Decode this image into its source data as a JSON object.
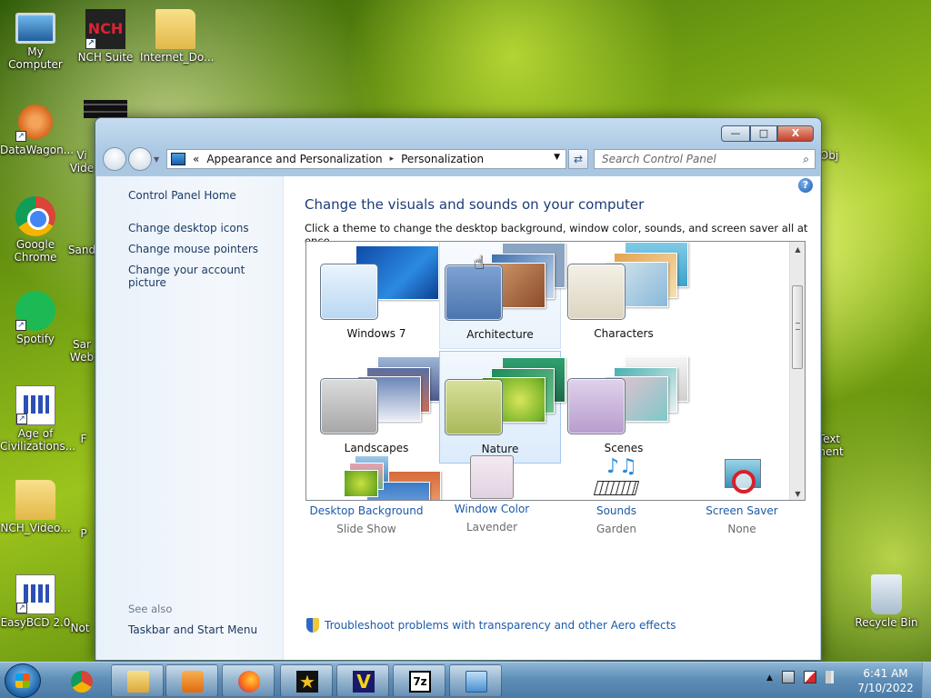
{
  "desktop": {
    "icons": [
      {
        "label": "My Computer"
      },
      {
        "label": "NCH Suite"
      },
      {
        "label": "Internet_Do..."
      },
      {
        "label": "DataWagon..."
      },
      {
        "label": "Google Chrome"
      },
      {
        "label": "Spotify"
      },
      {
        "label": "Age of Civilizations..."
      },
      {
        "label": "NCH_Video..."
      },
      {
        "label": "EasyBCD 2.0"
      },
      {
        "label": "Recycle Bin"
      }
    ],
    "partial_labels": [
      "Vi",
      "Vide",
      "Sand",
      "Sar",
      "Web",
      "F",
      "P",
      "Not",
      "Obj",
      "Text",
      "ment"
    ]
  },
  "window": {
    "buttons": {
      "minimize": "—",
      "maximize": "□",
      "close": "X"
    },
    "address": {
      "chevrons": "«",
      "crumbs": [
        "Appearance and Personalization",
        "Personalization"
      ],
      "separator": "▸",
      "dropdown": "▼"
    },
    "refresh_glyph": "⇄",
    "search": {
      "placeholder": "Search Control Panel",
      "icon": "⌕"
    },
    "left_pane": {
      "home": "Control Panel Home",
      "links": [
        "Change desktop icons",
        "Change mouse pointers",
        "Change your account picture"
      ],
      "see_also": "See also",
      "see_also_links": [
        "Taskbar and Start Menu"
      ]
    },
    "help": "?",
    "title": "Change the visuals and sounds on your computer",
    "description": "Click a theme to change the desktop background, window color, sounds, and screen saver all at once.",
    "themes": [
      {
        "name": "Windows 7",
        "swatch": "#cfe4f7",
        "cards": [
          "#1a57b8",
          "#2f7fd6"
        ]
      },
      {
        "name": "Architecture",
        "swatch": "#6a8fc4",
        "cards": [
          "#8aa4c2",
          "#c4874f",
          "#3d6fae"
        ]
      },
      {
        "name": "Characters",
        "swatch": "#e8e2d4",
        "cards": [
          "#7fcbe8",
          "#e4a24f",
          "#89b9d9"
        ]
      },
      {
        "name": "Landscapes",
        "swatch": "#b8b8b8",
        "cards": [
          "#9db5d8",
          "#4c5a8a",
          "#d8d4d0"
        ]
      },
      {
        "name": "Nature",
        "swatch": "#b9c873",
        "cards": [
          "#1e8a5a",
          "#7bb52b",
          "#b3d23d"
        ]
      },
      {
        "name": "Scenes",
        "swatch": "#c7b3d8",
        "cards": [
          "#e8e8e8",
          "#4ab0b0",
          "#f0c0d0"
        ]
      }
    ],
    "scroll": {
      "up": "▲",
      "down": "▼"
    },
    "bottom_items": [
      {
        "label": "Desktop Background",
        "sub": "Slide Show"
      },
      {
        "label": "Window Color",
        "sub": "Lavender",
        "color": "#ece1ea"
      },
      {
        "label": "Sounds",
        "sub": "Garden"
      },
      {
        "label": "Screen Saver",
        "sub": "None"
      }
    ],
    "troubleshoot": "Troubleshoot problems with transparency and other Aero effects"
  },
  "taskbar": {
    "apps": [
      "chrome",
      "explorer",
      "media-player",
      "firefox",
      "movie-maker",
      "vlc-like",
      "7zip",
      "control-panel"
    ],
    "label_7z": "7z",
    "tray_arrow": "▲",
    "clock": {
      "time": "6:41 AM",
      "date": "7/10/2022"
    }
  },
  "colors": {
    "accent": "#1c5aa8",
    "title": "#1c3c78",
    "taskbar": "#5f8fb7"
  }
}
